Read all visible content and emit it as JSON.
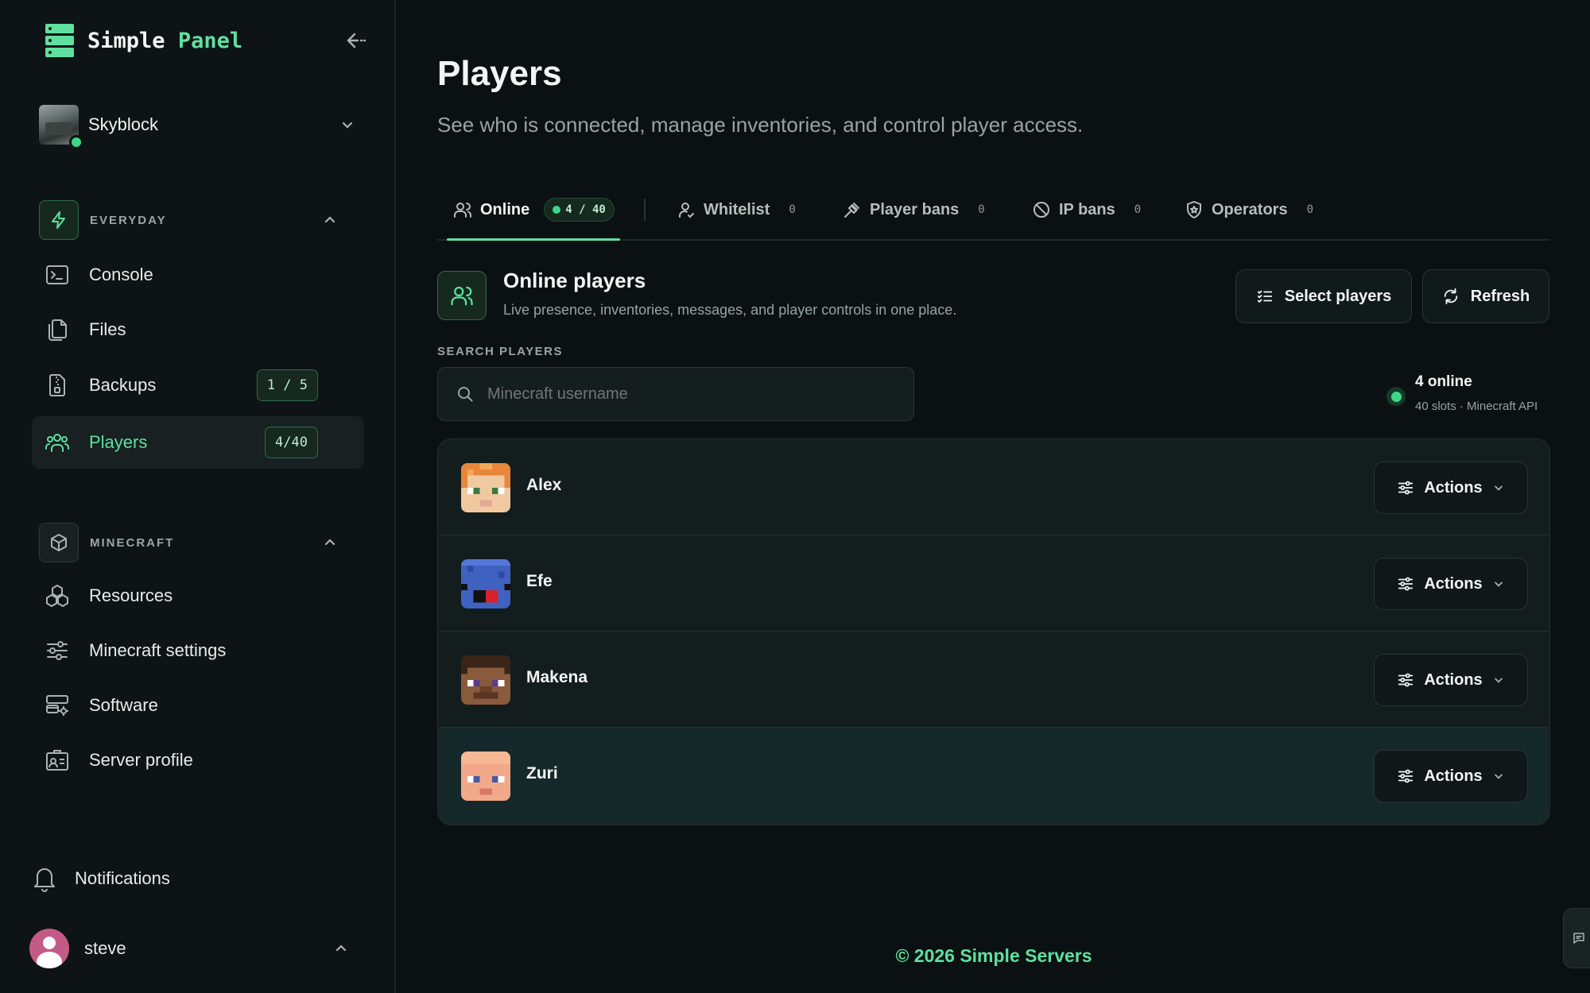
{
  "app": {
    "logo_part1": "Simple",
    "logo_part2": "Panel"
  },
  "server": {
    "name": "Skyblock",
    "status": "online"
  },
  "sidebar": {
    "sections": [
      {
        "title": "EVERYDAY",
        "items": [
          {
            "label": "Console",
            "icon": "terminal-icon"
          },
          {
            "label": "Files",
            "icon": "files-icon"
          },
          {
            "label": "Backups",
            "icon": "archive-icon",
            "badge": "1 / 5"
          },
          {
            "label": "Players",
            "icon": "users-icon",
            "badge": "4/40",
            "active": true
          }
        ]
      },
      {
        "title": "MINECRAFT",
        "items": [
          {
            "label": "Resources",
            "icon": "boxes-icon"
          },
          {
            "label": "Minecraft settings",
            "icon": "sliders-icon"
          },
          {
            "label": "Software",
            "icon": "server-cog-icon"
          },
          {
            "label": "Server profile",
            "icon": "id-card-icon"
          }
        ]
      }
    ],
    "notifications": "Notifications",
    "user": "steve"
  },
  "page": {
    "title": "Players",
    "subtitle": "See who is connected, manage inventories, and control player access."
  },
  "tabs": [
    {
      "label": "Online",
      "count": "4 / 40",
      "active": true
    },
    {
      "label": "Whitelist",
      "count": "0"
    },
    {
      "label": "Player bans",
      "count": "0"
    },
    {
      "label": "IP bans",
      "count": "0"
    },
    {
      "label": "Operators",
      "count": "0"
    }
  ],
  "online": {
    "title": "Online players",
    "description": "Live presence, inventories, messages, and player controls in one place.",
    "select_label": "Select players",
    "refresh_label": "Refresh",
    "search_label": "SEARCH PLAYERS",
    "search_placeholder": "Minecraft username",
    "status_main": "4 online",
    "status_sub": "40 slots · Minecraft API",
    "action_label": "Actions",
    "players": [
      {
        "name": "Alex"
      },
      {
        "name": "Efe"
      },
      {
        "name": "Makena"
      },
      {
        "name": "Zuri"
      }
    ]
  },
  "footer": "© 2026 Simple Servers",
  "colors": {
    "accent": "#5fe0a0",
    "background": "#0b1112",
    "sidebar": "#0e1415",
    "panel": "#131d1e"
  }
}
